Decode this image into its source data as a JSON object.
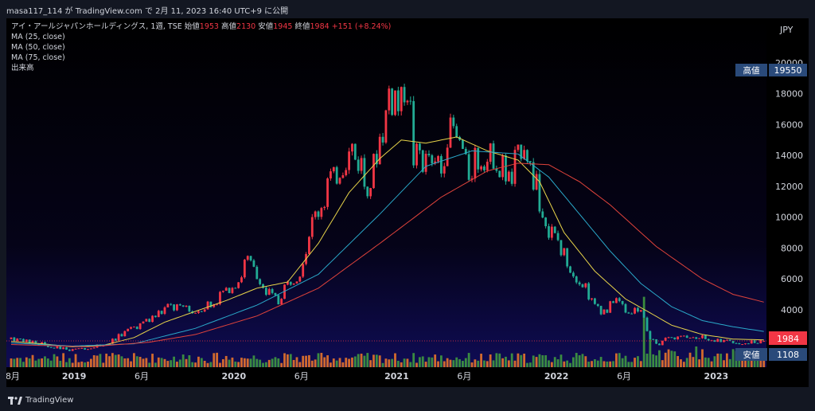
{
  "header": {
    "text": "masa117_114 が TradingView.com で 2月 11, 2023 16:40 UTC+9 に公開"
  },
  "legend": {
    "symbol": "アイ・アールジャパンホールディングス, 1週, TSE",
    "open_label": "始値",
    "open": "1953",
    "high_label": "高値",
    "high": "2130",
    "low_label": "安値",
    "low": "1945",
    "close_label": "終値",
    "close": "1984",
    "change": "+151 (+8.24%)",
    "ma25": "MA (25, close)",
    "ma50": "MA (50, close)",
    "ma75": "MA (75, close)",
    "volume": "出来高"
  },
  "currency": "JPY",
  "badges": {
    "high_label": "高値",
    "high_value": "19550",
    "last_value": "1984",
    "low_label": "安値",
    "low_value": "1108"
  },
  "brand": "TradingView",
  "colors": {
    "up": "#f23645",
    "down": "#22ab94",
    "ma25": "#e8d44a",
    "ma50": "#2aa8c9",
    "ma75": "#e0433b",
    "badge": "#2a4a7a"
  },
  "chart_data": {
    "type": "line",
    "y_ticks": [
      2000,
      4000,
      6000,
      8000,
      10000,
      12000,
      14000,
      16000,
      18000,
      20000
    ],
    "ylim": [
      800,
      21000
    ],
    "x_ticks": [
      "8月",
      "2019",
      "6月",
      "2020",
      "6月",
      "2021",
      "6月",
      "2022",
      "6月",
      "2023"
    ],
    "x_tick_pos": [
      0.5,
      20.5,
      42.5,
      72.5,
      94.5,
      125.5,
      147.5,
      177.5,
      199.5,
      229.5
    ],
    "n_weeks": 246,
    "price_anchors": [
      [
        0,
        2100
      ],
      [
        8,
        1900
      ],
      [
        14,
        1600
      ],
      [
        20,
        1400
      ],
      [
        26,
        1550
      ],
      [
        32,
        1900
      ],
      [
        36,
        2400
      ],
      [
        40,
        2800
      ],
      [
        44,
        3200
      ],
      [
        48,
        3800
      ],
      [
        52,
        4200
      ],
      [
        56,
        4000
      ],
      [
        62,
        4100
      ],
      [
        66,
        4500
      ],
      [
        70,
        5200
      ],
      [
        74,
        6000
      ],
      [
        77,
        7200
      ],
      [
        80,
        6200
      ],
      [
        84,
        5000
      ],
      [
        87,
        4600
      ],
      [
        90,
        5600
      ],
      [
        94,
        6500
      ],
      [
        97,
        9000
      ],
      [
        100,
        10500
      ],
      [
        104,
        12200
      ],
      [
        108,
        13300
      ],
      [
        112,
        14300
      ],
      [
        116,
        12200
      ],
      [
        120,
        14500
      ],
      [
        123,
        17200
      ],
      [
        127,
        17800
      ],
      [
        129,
        18800
      ],
      [
        131,
        14200
      ],
      [
        134,
        13500
      ],
      [
        137,
        13000
      ],
      [
        140,
        13500
      ],
      [
        143,
        15800
      ],
      [
        146,
        14200
      ],
      [
        149,
        13200
      ],
      [
        152,
        13800
      ],
      [
        155,
        14100
      ],
      [
        158,
        13800
      ],
      [
        162,
        12500
      ],
      [
        165,
        14000
      ],
      [
        167,
        15200
      ],
      [
        169,
        13000
      ],
      [
        171,
        12000
      ],
      [
        173,
        10300
      ],
      [
        175,
        9200
      ],
      [
        178,
        8100
      ],
      [
        181,
        7200
      ],
      [
        184,
        6200
      ],
      [
        187,
        5400
      ],
      [
        190,
        4100
      ],
      [
        193,
        3800
      ],
      [
        196,
        4600
      ],
      [
        199,
        4200
      ],
      [
        202,
        3900
      ],
      [
        205,
        4100
      ],
      [
        207,
        2500
      ],
      [
        210,
        1700
      ],
      [
        213,
        2050
      ],
      [
        217,
        2200
      ],
      [
        222,
        2300
      ],
      [
        228,
        2100
      ],
      [
        234,
        1900
      ],
      [
        240,
        1900
      ],
      [
        245,
        1984
      ]
    ],
    "ma25": [
      [
        0,
        1950
      ],
      [
        10,
        1800
      ],
      [
        20,
        1600
      ],
      [
        30,
        1700
      ],
      [
        40,
        2200
      ],
      [
        50,
        3200
      ],
      [
        60,
        3900
      ],
      [
        70,
        4600
      ],
      [
        80,
        5400
      ],
      [
        90,
        5800
      ],
      [
        100,
        8300
      ],
      [
        110,
        11600
      ],
      [
        120,
        13800
      ],
      [
        127,
        15000
      ],
      [
        135,
        14800
      ],
      [
        145,
        15200
      ],
      [
        155,
        14300
      ],
      [
        165,
        13700
      ],
      [
        172,
        12300
      ],
      [
        180,
        9000
      ],
      [
        190,
        6500
      ],
      [
        200,
        4700
      ],
      [
        208,
        3800
      ],
      [
        215,
        3000
      ],
      [
        225,
        2400
      ],
      [
        235,
        2100
      ],
      [
        245,
        2050
      ]
    ],
    "ma50": [
      [
        0,
        1850
      ],
      [
        20,
        1650
      ],
      [
        40,
        1800
      ],
      [
        60,
        2800
      ],
      [
        80,
        4300
      ],
      [
        100,
        6300
      ],
      [
        120,
        10200
      ],
      [
        135,
        13300
      ],
      [
        150,
        14300
      ],
      [
        165,
        14100
      ],
      [
        175,
        12600
      ],
      [
        185,
        10200
      ],
      [
        195,
        7800
      ],
      [
        205,
        5700
      ],
      [
        215,
        4200
      ],
      [
        225,
        3300
      ],
      [
        235,
        2900
      ],
      [
        245,
        2600
      ]
    ],
    "ma75": [
      [
        0,
        1750
      ],
      [
        25,
        1600
      ],
      [
        45,
        1900
      ],
      [
        60,
        2400
      ],
      [
        80,
        3600
      ],
      [
        100,
        5400
      ],
      [
        120,
        8300
      ],
      [
        140,
        11300
      ],
      [
        155,
        13000
      ],
      [
        165,
        13500
      ],
      [
        175,
        13400
      ],
      [
        185,
        12300
      ],
      [
        195,
        10800
      ],
      [
        210,
        8100
      ],
      [
        225,
        6000
      ],
      [
        235,
        5000
      ],
      [
        245,
        4500
      ]
    ],
    "volume_spikes": [
      [
        206,
        3400
      ],
      [
        208,
        1400
      ],
      [
        223,
        1000
      ],
      [
        231,
        650
      ]
    ]
  }
}
